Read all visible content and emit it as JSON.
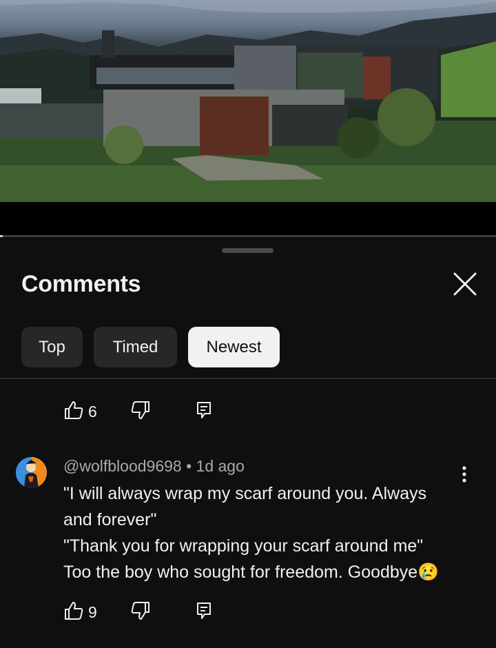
{
  "video": {
    "progress_fraction": 0.005
  },
  "comments_panel": {
    "title": "Comments",
    "close_icon": "close-icon",
    "filters": [
      {
        "label": "Top",
        "active": false
      },
      {
        "label": "Timed",
        "active": false
      },
      {
        "label": "Newest",
        "active": true
      }
    ]
  },
  "previous_comment": {
    "likes": "6"
  },
  "comment": {
    "author": "@wolfblood9698",
    "age": "1d ago",
    "lines": [
      "\"I will always wrap my scarf around you. Always",
      "and forever\"",
      "\"Thank you for wrapping your scarf around me\"",
      "Too the boy who sought for freedom. Goodbye"
    ],
    "emoji": "😢",
    "likes": "9"
  },
  "icons": [
    "like-icon",
    "dislike-icon",
    "reply-icon",
    "more-vertical-icon",
    "avatar"
  ]
}
